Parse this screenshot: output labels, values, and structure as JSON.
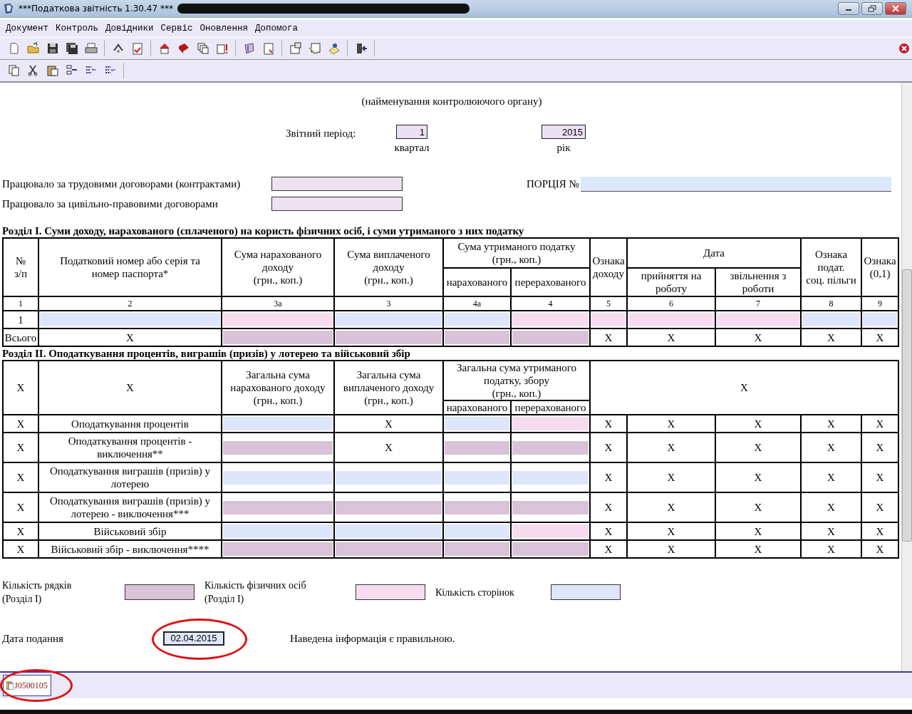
{
  "window": {
    "title": "***Податкова звітність 1.30.47 ***"
  },
  "menu": [
    "Документ",
    "Контроль",
    "Довідники",
    "Сервіс",
    "Оновлення",
    "Допомога"
  ],
  "form": {
    "authority_caption": "(найменування контролюючого органу)",
    "period": {
      "label": "Звітний період:",
      "quarter": {
        "value": "1",
        "caption": "квартал"
      },
      "year": {
        "value": "2015",
        "caption": "рік"
      }
    },
    "workers": [
      {
        "label": "Працювало за трудовими договорами (контрактами)"
      },
      {
        "label": "Працювало за цивільно-правовими договорами"
      }
    ],
    "portion": {
      "label": "ПОРЦІЯ №"
    },
    "sections": [
      {
        "title": "Розділ I. Суми доходу, нарахованого (сплаченого) на користь фізичних осіб, і суми утриманого з них податку",
        "header_rows": [
          [
            "№\nз/п",
            "Податковий номер або серія та\nномер паспорта*",
            "Сума нарахованого\nдоходу\n(грн., коп.)",
            "Сума виплаченого\nдоходу\n(грн., коп.)",
            "Сума утриманого податку\n(грн., коп.)",
            "Ознака\nдоходу",
            "Дата",
            "Ознака\nподат.\nсоц. пільги",
            "Ознака\n(0,1)"
          ],
          [
            "нарахованого",
            "перерахованого",
            "прийняття на\nроботу",
            "звільнення з\nроботи"
          ]
        ],
        "numbers": [
          "1",
          "2",
          "3а",
          "3",
          "4а",
          "4",
          "5",
          "6",
          "7",
          "8",
          "9"
        ],
        "rows": [
          [
            {
              "kind": "text",
              "text": "1"
            },
            {
              "kind": "entry"
            },
            {
              "kind": "required"
            },
            {
              "kind": "entry"
            },
            {
              "kind": "entry"
            },
            {
              "kind": "required"
            },
            {
              "kind": "required"
            },
            {
              "kind": "required"
            },
            {
              "kind": "required"
            },
            {
              "kind": "entry"
            },
            {
              "kind": "entry"
            }
          ],
          [
            {
              "kind": "text",
              "text": "Всього"
            },
            {
              "kind": "text",
              "text": "X"
            },
            {
              "kind": "computed"
            },
            {
              "kind": "computed"
            },
            {
              "kind": "computed"
            },
            {
              "kind": "computed"
            },
            {
              "kind": "text",
              "text": "X"
            },
            {
              "kind": "text",
              "text": "X"
            },
            {
              "kind": "text",
              "text": "X"
            },
            {
              "kind": "text",
              "text": "X"
            },
            {
              "kind": "text",
              "text": "X"
            }
          ]
        ]
      },
      {
        "title": "Розділ II. Оподаткування процентів, виграшів (призів) у лотерею та військовий збір",
        "header_rows": [
          [
            "X",
            "X",
            "Загальна сума\nнарахованого доходу\n(грн., коп.)",
            "Загальна сума\nвиплаченого доходу\n(грн., коп.)",
            "Загальна сума утриманого\nподатку, збору\n(грн., коп.)",
            "X"
          ],
          [
            "нарахованого",
            "перерахованого"
          ]
        ],
        "rows": [
          [
            {
              "kind": "text",
              "text": "X"
            },
            {
              "kind": "text",
              "text": "Оподаткування процентів"
            },
            {
              "kind": "entry"
            },
            {
              "kind": "text",
              "text": "X"
            },
            {
              "kind": "entry"
            },
            {
              "kind": "required"
            },
            {
              "kind": "text",
              "text": "X"
            },
            {
              "kind": "text",
              "text": "X"
            },
            {
              "kind": "text",
              "text": "X"
            },
            {
              "kind": "text",
              "text": "X"
            },
            {
              "kind": "text",
              "text": "X"
            }
          ],
          [
            {
              "kind": "text",
              "text": "X"
            },
            {
              "kind": "text",
              "text": "Оподаткування процентів -\nвиключення**"
            },
            {
              "kind": "computed"
            },
            {
              "kind": "text",
              "text": "X"
            },
            {
              "kind": "computed"
            },
            {
              "kind": "computed"
            },
            {
              "kind": "text",
              "text": "X"
            },
            {
              "kind": "text",
              "text": "X"
            },
            {
              "kind": "text",
              "text": "X"
            },
            {
              "kind": "text",
              "text": "X"
            },
            {
              "kind": "text",
              "text": "X"
            }
          ],
          [
            {
              "kind": "text",
              "text": "X"
            },
            {
              "kind": "text",
              "text": "Оподаткування виграшів (призів) у\nлотерею"
            },
            {
              "kind": "entry"
            },
            {
              "kind": "entry"
            },
            {
              "kind": "entry"
            },
            {
              "kind": "entry"
            },
            {
              "kind": "text",
              "text": "X"
            },
            {
              "kind": "text",
              "text": "X"
            },
            {
              "kind": "text",
              "text": "X"
            },
            {
              "kind": "text",
              "text": "X"
            },
            {
              "kind": "text",
              "text": "X"
            }
          ],
          [
            {
              "kind": "text",
              "text": "X"
            },
            {
              "kind": "text",
              "text": "Оподаткування виграшів (призів) у\nлотерею - виключення***"
            },
            {
              "kind": "computed"
            },
            {
              "kind": "computed"
            },
            {
              "kind": "computed"
            },
            {
              "kind": "computed"
            },
            {
              "kind": "text",
              "text": "X"
            },
            {
              "kind": "text",
              "text": "X"
            },
            {
              "kind": "text",
              "text": "X"
            },
            {
              "kind": "text",
              "text": "X"
            },
            {
              "kind": "text",
              "text": "X"
            }
          ],
          [
            {
              "kind": "text",
              "text": "X"
            },
            {
              "kind": "text",
              "text": "Військовий збір"
            },
            {
              "kind": "entry"
            },
            {
              "kind": "entry"
            },
            {
              "kind": "entry"
            },
            {
              "kind": "required"
            },
            {
              "kind": "text",
              "text": "X"
            },
            {
              "kind": "text",
              "text": "X"
            },
            {
              "kind": "text",
              "text": "X"
            },
            {
              "kind": "text",
              "text": "X"
            },
            {
              "kind": "text",
              "text": "X"
            }
          ],
          [
            {
              "kind": "text",
              "text": "X"
            },
            {
              "kind": "text",
              "text": "Військовий збір - виключення****"
            },
            {
              "kind": "computed"
            },
            {
              "kind": "computed"
            },
            {
              "kind": "computed"
            },
            {
              "kind": "computed"
            },
            {
              "kind": "text",
              "text": "X"
            },
            {
              "kind": "text",
              "text": "X"
            },
            {
              "kind": "text",
              "text": "X"
            },
            {
              "kind": "text",
              "text": "X"
            },
            {
              "kind": "text",
              "text": "X"
            }
          ]
        ]
      }
    ],
    "counts": [
      {
        "label": "Кількість рядків\n(Розділ I)",
        "kind": "computed"
      },
      {
        "label": "Кількість фізичних осіб\n(Розділ I)",
        "kind": "required"
      },
      {
        "label": "Кількість сторінок",
        "kind": "entry"
      }
    ],
    "date": {
      "label": "Дата подання",
      "value": "02.04.2015",
      "circled": true
    },
    "statement": "Наведена інформація є правильною."
  },
  "tabs": [
    {
      "label": "J0500105",
      "selected": true,
      "circled": true
    }
  ]
}
